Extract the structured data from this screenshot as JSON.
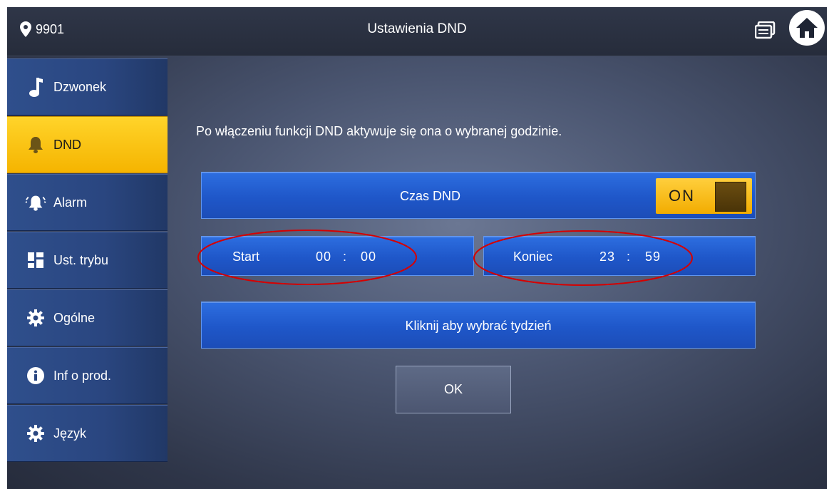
{
  "header": {
    "room_number": "9901",
    "title": "Ustawienia DND"
  },
  "sidebar": {
    "items": [
      {
        "label": "Dzwonek",
        "icon": "music-note-icon"
      },
      {
        "label": "DND",
        "icon": "bell-icon",
        "active": true
      },
      {
        "label": "Alarm",
        "icon": "alarm-bell-icon"
      },
      {
        "label": "Ust. trybu",
        "icon": "mode-grid-icon"
      },
      {
        "label": "Ogólne",
        "icon": "gear-icon"
      },
      {
        "label": "Inf o prod.",
        "icon": "info-icon"
      },
      {
        "label": "Język",
        "icon": "gear-icon"
      }
    ]
  },
  "main": {
    "description": "Po włączeniu funkcji DND aktywuje się ona o wybranej godzinie.",
    "dnd_time_label": "Czas DND",
    "dnd_toggle": "ON",
    "start": {
      "label": "Start",
      "hour": "00",
      "minute": "00"
    },
    "end": {
      "label": "Koniec",
      "hour": "23",
      "minute": "59"
    },
    "week_button": "Kliknij aby wybrać tydzień",
    "ok_button": "OK"
  },
  "colors": {
    "active_tab": "#f5b400",
    "bar_blue": "#1f57c9",
    "annotation": "#d60000"
  }
}
